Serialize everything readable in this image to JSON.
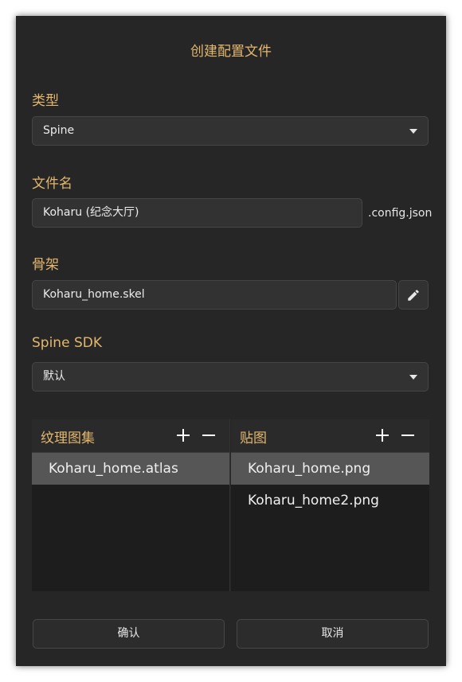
{
  "dialog": {
    "title": "创建配置文件"
  },
  "type_section": {
    "label": "类型",
    "value": "Spine"
  },
  "filename_section": {
    "label": "文件名",
    "value": "Koharu (纪念大厅)",
    "suffix": ".config.json"
  },
  "skeleton_section": {
    "label": "骨架",
    "value": "Koharu_home.skel"
  },
  "sdk_section": {
    "label": "Spine SDK",
    "value": "默认"
  },
  "atlas_panel": {
    "title": "纹理图集",
    "items": [
      "Koharu_home.atlas"
    ],
    "selected_index": 0
  },
  "texture_panel": {
    "title": "贴图",
    "items": [
      "Koharu_home.png",
      "Koharu_home2.png"
    ],
    "selected_index": 0
  },
  "buttons": {
    "confirm": "确认",
    "cancel": "取消"
  },
  "colors": {
    "accent": "#e3b76e",
    "background": "#262626",
    "field": "#323232",
    "selected": "#565656"
  },
  "icons": {
    "dropdown": "chevron-down-icon",
    "edit": "pencil-icon",
    "add": "plus-icon",
    "remove": "minus-icon"
  }
}
